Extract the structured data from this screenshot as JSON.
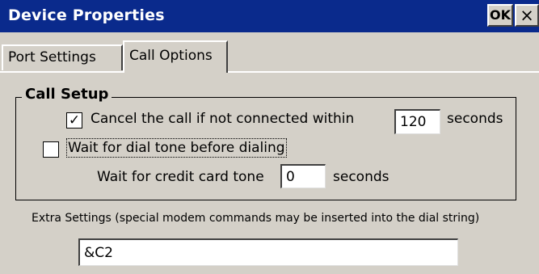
{
  "window": {
    "title": "Device Properties",
    "ok_label": "OK",
    "close_label": "×"
  },
  "tabs": [
    {
      "label": "Port Settings",
      "selected": false
    },
    {
      "label": "Call Options",
      "selected": true
    }
  ],
  "call_setup": {
    "group_title": "Call Setup",
    "cancel_call": {
      "checked": true,
      "check_glyph": "✓",
      "label": "Cancel the call if not connected within",
      "value": "120",
      "unit": "seconds"
    },
    "wait_dial_tone": {
      "checked": false,
      "label": "Wait for dial tone before dialing"
    },
    "credit_card": {
      "label": "Wait for credit card tone",
      "value": "0",
      "unit": "seconds"
    }
  },
  "extra_settings": {
    "label": "Extra Settings (special modem commands may be inserted into the dial string)",
    "value": "&C2"
  },
  "colors": {
    "titlebar": "#0a2a8c",
    "face": "#d4d0c8"
  }
}
